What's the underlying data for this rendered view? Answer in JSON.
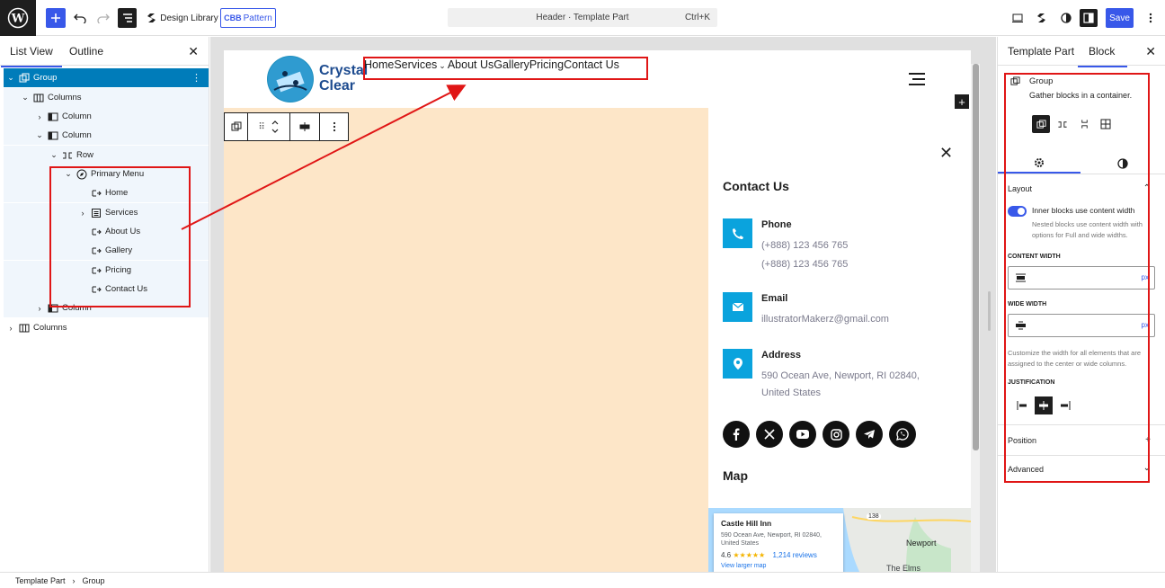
{
  "toolbar": {
    "design_library_label": "Design Library",
    "pattern_label": "Pattern",
    "pattern_badge": "CBB",
    "document_title": "Header · Template Part",
    "shortcut": "Ctrl+K",
    "save_label": "Save"
  },
  "left_panel": {
    "tabs": [
      "List View",
      "Outline"
    ],
    "tree": [
      {
        "label": "Group",
        "icon": "group-icon"
      },
      {
        "label": "Columns",
        "icon": "columns-icon"
      },
      {
        "label": "Column",
        "icon": "column-icon"
      },
      {
        "label": "Column",
        "icon": "column-icon"
      },
      {
        "label": "Row",
        "icon": "row-icon"
      },
      {
        "label": "Primary Menu",
        "icon": "navigation-icon"
      },
      {
        "label": "Home",
        "icon": "custom-link-icon"
      },
      {
        "label": "Services",
        "icon": "submenu-icon"
      },
      {
        "label": "About Us",
        "icon": "custom-link-icon"
      },
      {
        "label": "Gallery",
        "icon": "custom-link-icon"
      },
      {
        "label": "Pricing",
        "icon": "custom-link-icon"
      },
      {
        "label": "Contact Us",
        "icon": "custom-link-icon"
      },
      {
        "label": "Column",
        "icon": "column-icon"
      },
      {
        "label": "Columns",
        "icon": "columns-icon"
      }
    ]
  },
  "canvas": {
    "logo": {
      "line1": "Crystal",
      "line2": "Clear"
    },
    "nav_items": [
      "Home",
      "Services",
      "About Us",
      "Gallery",
      "Pricing",
      "Contact Us"
    ],
    "contact": {
      "heading": "Contact Us",
      "phone_title": "Phone",
      "phone_1": "(+888) 123 456 765",
      "phone_2": "(+888) 123 456 765",
      "email_title": "Email",
      "email": "illustratorMakerz@gmail.com",
      "address_title": "Address",
      "address_1": "590 Ocean Ave, Newport, RI 02840,",
      "address_2": "United States"
    },
    "social_icons": [
      "facebook-icon",
      "x-icon",
      "youtube-icon",
      "instagram-icon",
      "telegram-icon",
      "whatsapp-icon"
    ],
    "map_heading": "Map",
    "map_card": {
      "title": "Castle Hill Inn",
      "address_1": "590 Ocean Ave, Newport, RI 02840,",
      "address_2": "United States",
      "rating": "4.6",
      "stars": "★★★★★",
      "reviews": "1,214 reviews",
      "link": "View larger map"
    },
    "map_labels": {
      "city": "Newport",
      "poi": "The Elms",
      "road": "138"
    }
  },
  "right_panel": {
    "tabs": [
      "Template Part",
      "Block"
    ],
    "block_title": "Group",
    "block_desc": "Gather blocks in a container.",
    "layout_heading": "Layout",
    "toggle_label": "Inner blocks use content width",
    "toggle_help": "Nested blocks use content width with options for Full and wide widths.",
    "content_width_label": "CONTENT WIDTH",
    "wide_width_label": "WIDE WIDTH",
    "unit": "px",
    "width_help": "Customize the width for all elements that are assigned to the center or wide columns.",
    "justification_label": "JUSTIFICATION",
    "position_heading": "Position",
    "advanced_heading": "Advanced"
  },
  "breadcrumb": [
    "Template Part",
    "Group"
  ],
  "colors": {
    "accent": "#3858e9",
    "selection": "#007cba",
    "annotation": "#e01616",
    "contact_icon": "#0aa3dd",
    "peach": "#fde6c8"
  }
}
